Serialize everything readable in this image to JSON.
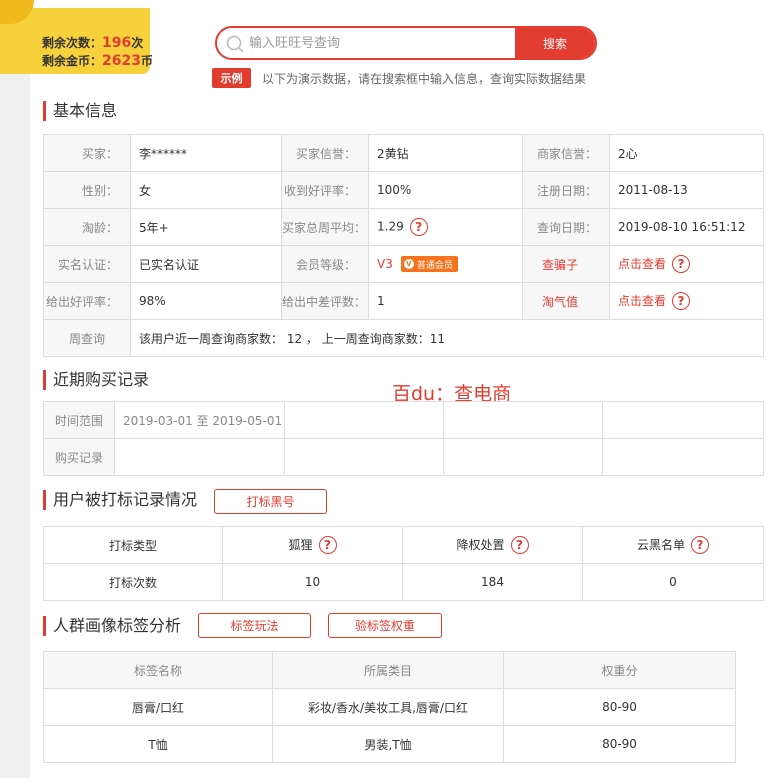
{
  "balance": {
    "count_label": "剩余次数：",
    "count_value": "196",
    "count_unit": "次",
    "coins_label": "剩余金币：",
    "coins_value": "2623",
    "coins_unit": "币"
  },
  "search": {
    "placeholder": "输入旺旺号查询",
    "button": "搜索",
    "demo_tag": "示例",
    "demo_text": "以下为演示数据，请在搜索框中输入信息，查询实际数据结果"
  },
  "basic_info": {
    "title": "基本信息",
    "rows": [
      [
        {
          "label": "买家：",
          "value": "李******"
        },
        {
          "label": "买家信誉：",
          "value": "2黄钻"
        },
        {
          "label": "商家信誉：",
          "value": "2心"
        }
      ],
      [
        {
          "label": "性别：",
          "value": "女"
        },
        {
          "label": "收到好评率：",
          "value": "100%"
        },
        {
          "label": "注册日期：",
          "value": "2011-08-13"
        }
      ],
      [
        {
          "label": "淘龄：",
          "value": "5年+"
        },
        {
          "label": "买家总周平均：",
          "value": "1.29"
        },
        {
          "label": "查询日期：",
          "value": "2019-08-10 16:51:12"
        }
      ],
      [
        {
          "label": "实名认证：",
          "value": "已实名认证"
        },
        {
          "label": "会员等级：",
          "value": "V3",
          "badge": "普通会员"
        },
        {
          "label": "查骗子",
          "value": "点击查看"
        }
      ],
      [
        {
          "label": "给出好评率：",
          "value": "98%"
        },
        {
          "label": "给出中差评数：",
          "value": "1"
        },
        {
          "label": "淘气值",
          "value": "点击查看"
        }
      ]
    ],
    "weekly_label": "周查询",
    "weekly_text": "该用户近一周查询商家数： 12 ， 上一周查询商家数：11"
  },
  "watermark": "百du：查电商",
  "purchase": {
    "title": "近期购买记录",
    "range_label": "时间范围",
    "range_value": "2019-03-01 至 2019-05-01",
    "record_label": "购买记录"
  },
  "flag": {
    "title": "用户被打标记录情况",
    "blacklist_button": "打标黑号",
    "headers": [
      "打标类型",
      "狐狸",
      "降权处置",
      "云黑名单"
    ],
    "row_label": "打标次数",
    "values": [
      "10",
      "184",
      "0"
    ]
  },
  "tags": {
    "title": "人群画像标签分析",
    "play_button": "标签玩法",
    "weight_button": "验标签权重",
    "headers": [
      "标签名称",
      "所属类目",
      "权重分"
    ],
    "rows": [
      [
        "唇膏/口红",
        "彩妆/香水/美妆工具,唇膏/口红",
        "80-90"
      ],
      [
        "T恤",
        "男装,T恤",
        "80-90"
      ]
    ]
  },
  "colors": {
    "accent": "#e23b2f",
    "badge_yellow": "#f7d13c",
    "vip_orange": "#f5731c"
  }
}
